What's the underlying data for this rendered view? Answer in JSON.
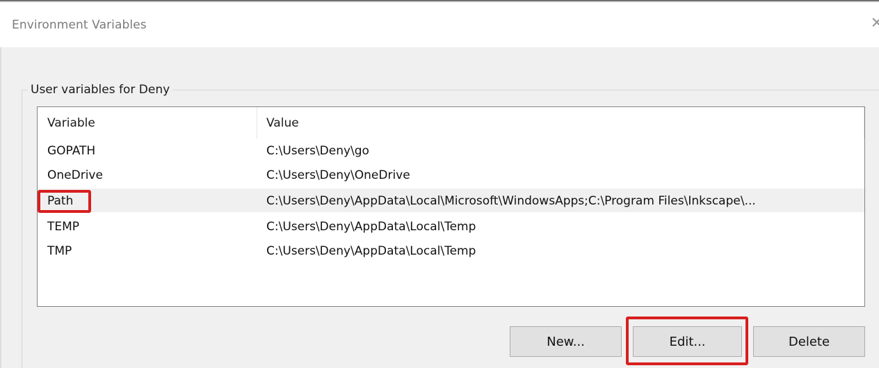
{
  "window": {
    "title": "Environment Variables",
    "close_glyph": "✕"
  },
  "user_group": {
    "label": "User variables for Deny",
    "columns": {
      "variable": "Variable",
      "value": "Value"
    },
    "rows": [
      {
        "variable": "GOPATH",
        "value": "C:\\Users\\Deny\\go"
      },
      {
        "variable": "OneDrive",
        "value": "C:\\Users\\Deny\\OneDrive"
      },
      {
        "variable": "Path",
        "value": "C:\\Users\\Deny\\AppData\\Local\\Microsoft\\WindowsApps;C:\\Program Files\\Inkscape\\..."
      },
      {
        "variable": "TEMP",
        "value": "C:\\Users\\Deny\\AppData\\Local\\Temp"
      },
      {
        "variable": "TMP",
        "value": "C:\\Users\\Deny\\AppData\\Local\\Temp"
      }
    ],
    "selected_row": 2
  },
  "buttons": {
    "new_label": "New...",
    "edit_label": "Edit...",
    "delete_label": "Delete"
  },
  "annotations": {
    "highlight_color": "#d91e1e"
  }
}
